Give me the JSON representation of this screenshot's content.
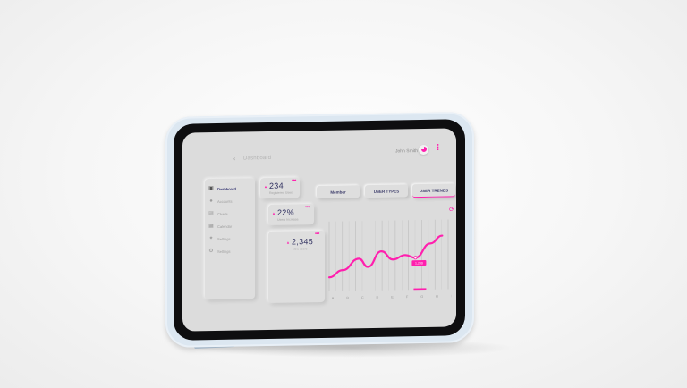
{
  "header": {
    "back_icon": "chevron-left-icon",
    "title": "Dashboard",
    "user_name": "John Smith",
    "more_icon": "vertical-dots-icon"
  },
  "sidebar": {
    "items": [
      {
        "label": "Dashboard",
        "icon": "dashboard-icon",
        "active": true
      },
      {
        "label": "Accounts",
        "icon": "accounts-icon",
        "active": false
      },
      {
        "label": "Charts",
        "icon": "charts-icon",
        "active": false
      },
      {
        "label": "Calendar",
        "icon": "calendar-icon",
        "active": false
      },
      {
        "label": "Settings",
        "icon": "settings-icon",
        "active": false
      },
      {
        "label": "Settings",
        "icon": "settings-icon",
        "active": false
      }
    ]
  },
  "stats": [
    {
      "value": "234",
      "label": "Registered Users",
      "trend": "up"
    },
    {
      "value": "22%",
      "label": "Users Increase",
      "trend": "up"
    },
    {
      "value": "2,345",
      "label": "New users",
      "trend": "up"
    }
  ],
  "tabs": [
    {
      "label": "Member",
      "active": false
    },
    {
      "label": "USER TYPES",
      "active": false
    },
    {
      "label": "USER TRENDS",
      "active": true
    }
  ],
  "chart_data": {
    "type": "line",
    "categories": [
      "A",
      "B",
      "C",
      "D",
      "E",
      "F",
      "G",
      "H",
      "I"
    ],
    "series": [
      {
        "values": [
          2,
          3,
          4.6,
          3.4,
          5.6,
          4.4,
          5.0,
          4.6,
          6.6,
          7.7
        ]
      }
    ],
    "x": [
      0,
      0.9,
      2.0,
      2.6,
      3.5,
      4.3,
      5.1,
      5.8,
      6.8,
      7.6
    ],
    "ylim": [
      0,
      10
    ],
    "tooltip": "1,200",
    "grid": true
  },
  "colors": {
    "accent": "#ff1fae",
    "screen_bg": "#dcdcdc",
    "text_dark": "#303060",
    "case": "#dce7f1"
  }
}
